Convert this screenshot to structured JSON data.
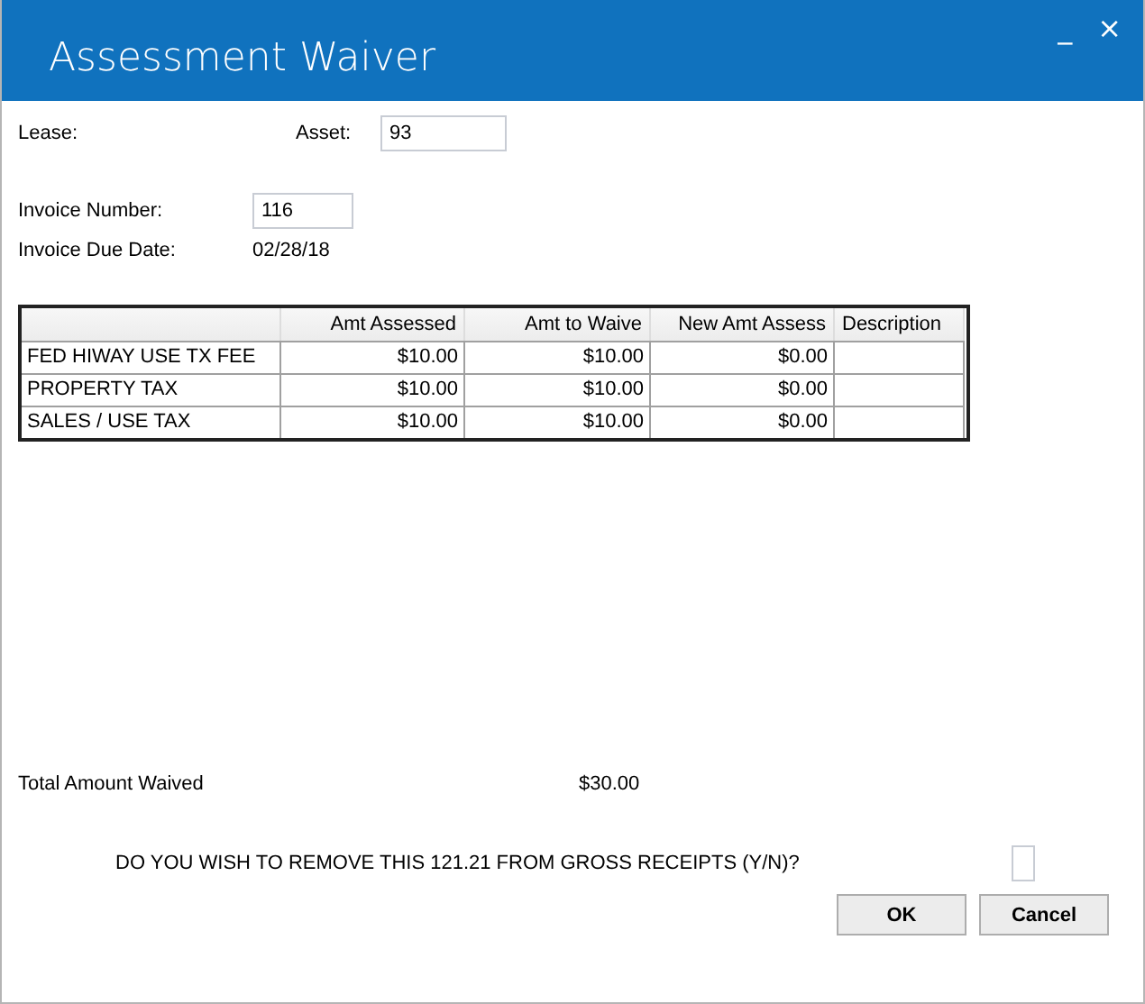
{
  "window": {
    "title": "Assessment Waiver",
    "controls": [
      "_",
      "×"
    ]
  },
  "lease": {
    "label": "Lease:"
  },
  "asset": {
    "label": "Asset:",
    "value": "93"
  },
  "invoice_number": {
    "label": "Invoice Number:",
    "value": "116"
  },
  "invoice_due_date": {
    "label": "Invoice Due Date:",
    "value": "02/28/18"
  },
  "table": {
    "columns": [
      "",
      "Amt Assessed",
      "Amt to Waive",
      "New Amt Assess",
      "Description"
    ],
    "rows": [
      [
        "FED HIWAY USE TX FEE",
        "$10.00",
        "$10.00",
        "$0.00",
        ""
      ],
      [
        "PROPERTY TAX",
        "$10.00",
        "$10.00",
        "$0.00",
        ""
      ],
      [
        "SALES / USE TAX",
        "$10.00",
        "$10.00",
        "$0.00",
        ""
      ]
    ]
  },
  "total": {
    "label": "Total Amount Waived",
    "value": "$30.00"
  },
  "question": {
    "text": "DO YOU WISH TO REMOVE THIS 121.21 FROM GROSS RECEIPTS (Y/N)?"
  },
  "buttons": [
    "OK",
    "Cancel"
  ]
}
